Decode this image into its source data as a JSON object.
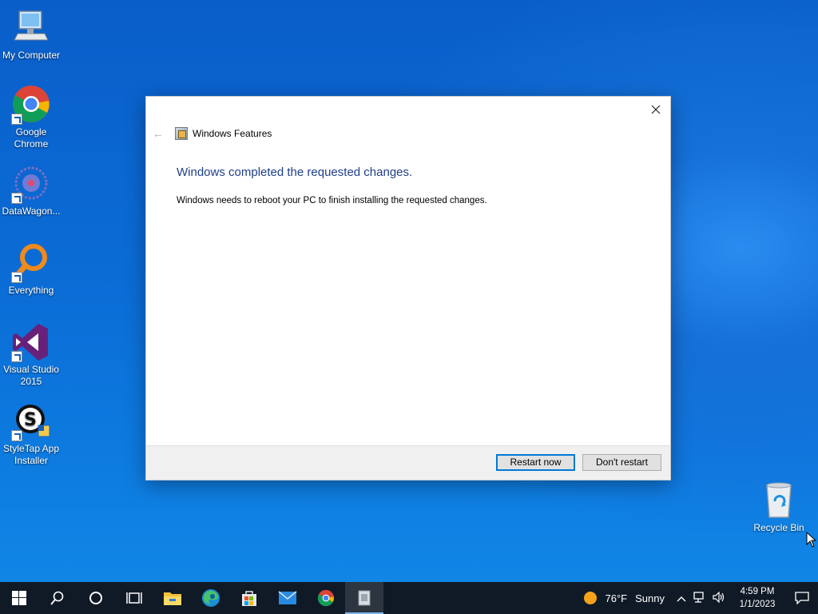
{
  "desktop": {
    "icons": [
      {
        "label": "My Computer",
        "icon": "computer-icon"
      },
      {
        "label": "Google Chrome",
        "icon": "chrome-icon"
      },
      {
        "label": "DataWagon...",
        "icon": "datawagon-icon"
      },
      {
        "label": "Everything",
        "icon": "everything-icon"
      },
      {
        "label": "Visual Studio 2015",
        "icon": "visual-studio-icon"
      },
      {
        "label": "StyleTap App Installer",
        "icon": "styletap-icon"
      },
      {
        "label": "Recycle Bin",
        "icon": "recycle-bin-icon"
      }
    ]
  },
  "dialog": {
    "nav_title": "Windows Features",
    "headline": "Windows completed the requested changes.",
    "message": "Windows needs to reboot your PC to finish installing the requested changes.",
    "buttons": {
      "restart": "Restart now",
      "dont_restart": "Don't restart"
    }
  },
  "taskbar": {
    "apps": [
      "start-icon",
      "search-icon",
      "cortana-icon",
      "task-view-icon",
      "file-explorer-icon",
      "edge-icon",
      "store-icon",
      "mail-icon",
      "chrome-icon",
      "windows-features-icon"
    ],
    "weather": {
      "temp": "76°F",
      "condition": "Sunny"
    },
    "clock": {
      "time": "4:59 PM",
      "date": "1/1/2023"
    }
  },
  "colors": {
    "accent": "#0078d7",
    "headline": "#1f3f8a",
    "taskbar": "#101a26"
  }
}
